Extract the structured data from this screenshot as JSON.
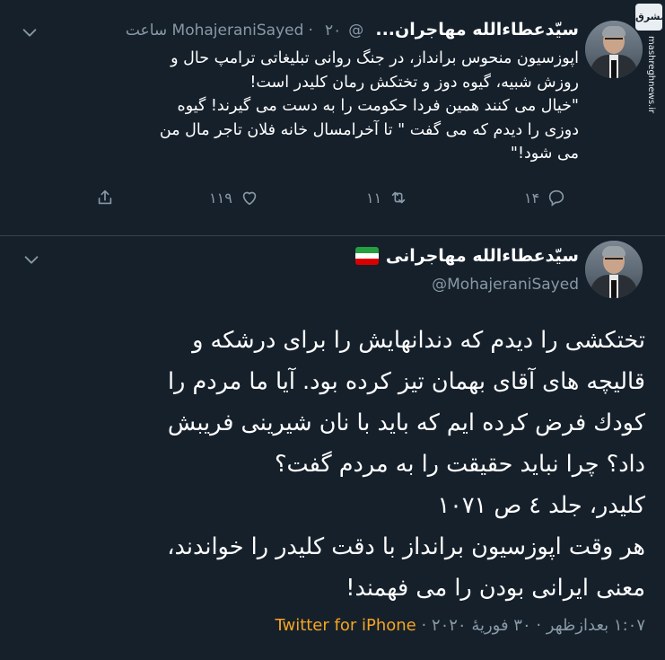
{
  "watermark": {
    "logo": "مشرق",
    "url": "mashreghnews.ir"
  },
  "tweet1": {
    "name": "سیّدعطاءالله مهاجران...",
    "handle": "@MohajeraniSayed",
    "time": "۲۰ ساعت",
    "separator": "·",
    "text": "اپوزسیون منحوس برانداز، در جنگ روانی تبلیغاتی ترامپ حال و\nروزش شبیه، گیوه دوز و تختکش رمان کلیدر است!\n\"خیال می کنند همین فردا حکومت را به دست می گیرند! گیوه\nدوزی را دیدم که می گفت \" تا آخرامسال خانه فلان تاجر مال من\nمی شود!\"",
    "replies": "۱۴",
    "retweets": "۱۱",
    "likes": "۱۱۹"
  },
  "tweet2": {
    "name": "سیّدعطاءالله مهاجرانی",
    "handle": "@MohajeraniSayed",
    "text": "تختکشی را دیدم که دندانهایش را برای درشکه و\nقالیچه های آقای بهمان تیز کرده بود. آیا ما مردم را\nکودك فرض کرده ایم که باید با نان شیرینی فریبش\nداد؟ چرا نباید حقیقت را به مردم گفت؟\nکلیدر، جلد ٤ ص ۱۰۷۱\nهر وقت اپوزسیون برانداز با دقت کلیدر را خواندند،\nمعنی ایرانی بودن را می فهمند!",
    "timestamp": "۱:۰۷ بعدازظهر · ۳۰ فوریهٔ ۲۰۲۰ ·",
    "app": "Twitter for iPhone"
  },
  "colors": {
    "background": "#15202b",
    "muted": "#8899a6",
    "divider": "#38444d",
    "app_link": "#f6a522"
  },
  "icons": [
    "chevron-down-icon",
    "reply-icon",
    "retweet-icon",
    "like-icon",
    "share-icon",
    "iran-flag-icon"
  ]
}
